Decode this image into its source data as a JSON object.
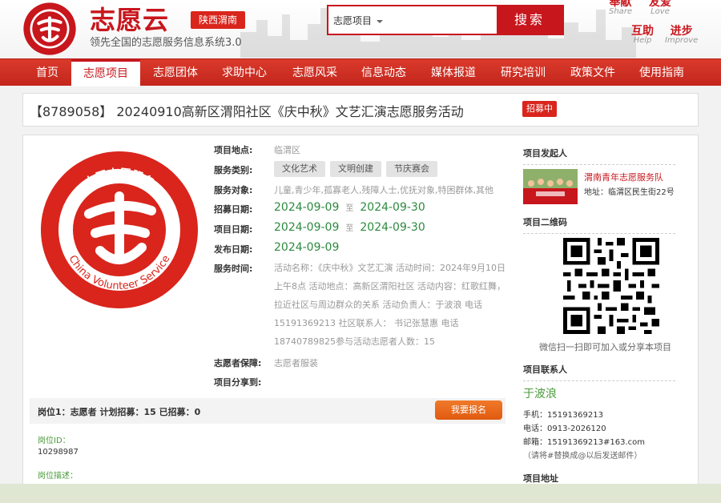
{
  "header": {
    "brand": "志愿云",
    "region": "陕西渭南",
    "slogan": "领先全国的志愿服务信息系统3.0",
    "logo_text_top": "中国志愿服务",
    "logo_text_bottom": "CHINA VOLUNTEER SERVICE",
    "search": {
      "category": "志愿项目",
      "button": "搜索",
      "placeholder": ""
    },
    "words": [
      {
        "cn": "奉献",
        "en": "Share"
      },
      {
        "cn": "友爱",
        "en": "Love"
      },
      {
        "cn": "互助",
        "en": "Help"
      },
      {
        "cn": "进步",
        "en": "Improve"
      }
    ]
  },
  "nav": [
    "首页",
    "志愿项目",
    "志愿团体",
    "求助中心",
    "志愿风采",
    "信息动态",
    "媒体报道",
    "研究培训",
    "政策文件",
    "使用指南"
  ],
  "project": {
    "title": "【8789058】 20240910高新区渭阳社区《庆中秋》文艺汇演志愿服务活动",
    "status": "招募中",
    "logo_text_top": "中国志愿服务",
    "logo_text_bottom": "China Volunteer Service",
    "labels": {
      "location": "项目地点:",
      "category": "服务类别:",
      "target": "服务对象:",
      "recruit": "招募日期:",
      "project_date": "项目日期:",
      "publish": "发布日期:",
      "time": "服务时间:",
      "insurance": "志愿者保障:",
      "share": "项目分享到:"
    },
    "location": "临渭区",
    "categories": [
      "文化艺术",
      "文明创建",
      "节庆赛会"
    ],
    "target": "儿童,青少年,孤寡老人,残障人士,优抚对象,特困群体,其他",
    "date_to": "至",
    "recruit_start": "2024-09-09",
    "recruit_end": "2024-09-30",
    "project_start": "2024-09-09",
    "project_end": "2024-09-30",
    "publish_date": "2024-09-09",
    "service_time": "活动名称：《庆中秋》文艺汇演 活动时间：2024年9月10日上午8点 活动地点：高新区渭阳社区 活动内容：红歌红舞，拉近社区与周边群众的关系 活动负责人：于波浪 电话15191369213 社区联系人： 书记张慧惠 电话18740789825参与活动志愿者人数：15",
    "insurance": "志愿者服装"
  },
  "post": {
    "title": "岗位1：志愿者   计划招募：15   已招募：0",
    "apply_button": "我要报名",
    "id_label": "岗位ID：",
    "id_value": "10298987",
    "desc_label": "岗位描述："
  },
  "sidebar": {
    "sponsor_heading": "项目发起人",
    "sponsor_name": "渭南青年志愿服务队",
    "sponsor_address": "地址：临渭区民生街22号",
    "qr_heading": "项目二维码",
    "qr_caption": "微信扫一扫即可加入或分享本项目",
    "contact_heading": "项目联系人",
    "contact_name": "于波浪",
    "phone": "手机：15191369213",
    "tel": "电话：0913-2026120",
    "email": "邮箱：15191369213#163.com",
    "email_note": "（请将#替换成@以后发送邮件）",
    "address_heading": "项目地址"
  },
  "colors": {
    "brand_red": "#c8161d",
    "date_green": "#2c8a3e",
    "apply_orange": "#e96b1c",
    "contact_green": "#4a9a3a"
  }
}
